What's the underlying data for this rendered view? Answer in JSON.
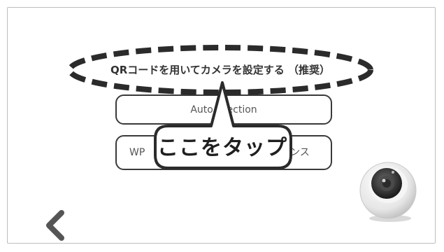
{
  "options": {
    "qr_label": "QRコードを用いてカメラを設定する （推奨）",
    "auto_label": "Auto D   ection",
    "wps_prefix": "WP",
    "wps_suffix": "ンス"
  },
  "callout": {
    "label": "ここをタップ"
  },
  "icons": {
    "back": "chevron-left-icon",
    "device": "camera-icon"
  },
  "colors": {
    "outline": "#2b2b2b",
    "text": "#444444"
  }
}
